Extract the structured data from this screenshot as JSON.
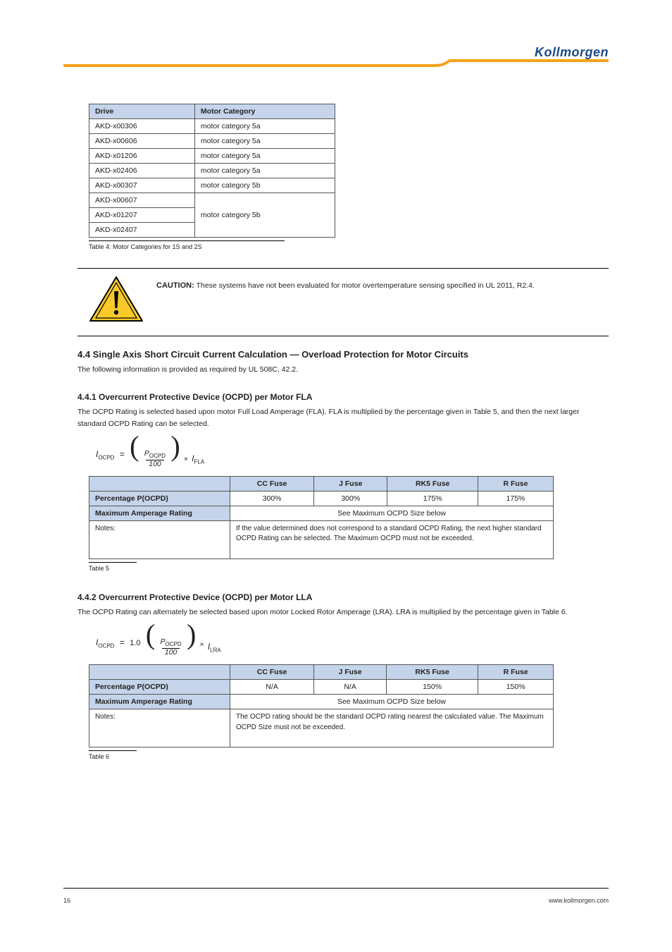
{
  "brand": "Kollmorgen",
  "header_rule_color": "#f5a11a",
  "table4": {
    "headers": [
      "Drive",
      "Motor Category"
    ],
    "rows": [
      [
        "AKD-x00306",
        "motor category 5a"
      ],
      [
        "AKD-x00606",
        "motor category 5a"
      ],
      [
        "AKD-x01206",
        "motor category 5a"
      ],
      [
        "AKD-x02406",
        "motor category 5a"
      ],
      [
        "AKD-x00307",
        "motor category 5b"
      ],
      [
        "AKD-x00607",
        ""
      ],
      [
        "AKD-x01207",
        "motor category 5b"
      ],
      [
        "AKD-x02407",
        ""
      ]
    ],
    "caption": "Table 4: Motor Categories for 1S and 2S"
  },
  "caution": {
    "label": "CAUTION:",
    "text": "These systems have not been evaluated for motor overtemperature sensing specified in UL 2011, R2.4."
  },
  "section": {
    "title": "4.4 Single Axis Short Circuit Current Calculation — Overload Protection for Motor Circuits",
    "intro": "The following information is provided as required by UL 508C, 42.2."
  },
  "ocpd1": {
    "heading": "4.4.1 Overcurrent Protective Device (OCPD) per Motor FLA",
    "para": "The OCPD Rating is selected based upon motor Full Load Amperage (FLA). FLA is multiplied by the percentage given in Table 5, and then the next larger standard OCPD Rating can be selected.",
    "formula_left": "I",
    "formula_left_sub": "OCPD",
    "frac_num": "P",
    "frac_num_sub": "OCPD",
    "frac_den": "100",
    "mult_var": "I",
    "mult_var_sub": "FLA"
  },
  "table5": {
    "headers": [
      "",
      "CC Fuse",
      "J Fuse",
      "RK5 Fuse",
      "R Fuse"
    ],
    "row_percent": [
      "Percentage P(OCPD)",
      "300%",
      "300%",
      "175%",
      "175%"
    ],
    "row_maxamp_label": "Maximum Amperage Rating",
    "row_maxamp_note": "See Maximum OCPD Size below",
    "note_label": "Notes:",
    "note_text": "If the value determined does not correspond to a standard OCPD Rating, the next higher standard OCPD Rating can be selected. The Maximum OCPD must not be exceeded.",
    "caption": "Table 5"
  },
  "ocpd2": {
    "heading": "4.4.2 Overcurrent Protective Device (OCPD) per Motor LLA",
    "para": "The OCPD Rating can alternately be selected based upon motor Locked Rotor Amperage (LRA). LRA is multiplied by the percentage given in Table 6.",
    "formula_left": "I",
    "formula_left_sub": "OCPD",
    "leading_const": "1.0",
    "frac_num": "P",
    "frac_num_sub": "OCPD",
    "frac_den": "100",
    "mult_var": "I",
    "mult_var_sub": "LRA"
  },
  "table6": {
    "headers": [
      "",
      "CC Fuse",
      "J Fuse",
      "RK5 Fuse",
      "R Fuse"
    ],
    "row_percent": [
      "Percentage P(OCPD)",
      "N/A",
      "N/A",
      "150%",
      "150%"
    ],
    "row_maxamp_label": "Maximum Amperage Rating",
    "row_maxamp_note": "See Maximum OCPD Size below",
    "note_label": "Notes:",
    "note_text": "The OCPD rating should be the standard OCPD rating nearest the calculated value. The Maximum OCPD Size must not be exceeded.",
    "caption": "Table 6"
  },
  "footer": {
    "left": "16",
    "right": "www.kollmorgen.com"
  }
}
